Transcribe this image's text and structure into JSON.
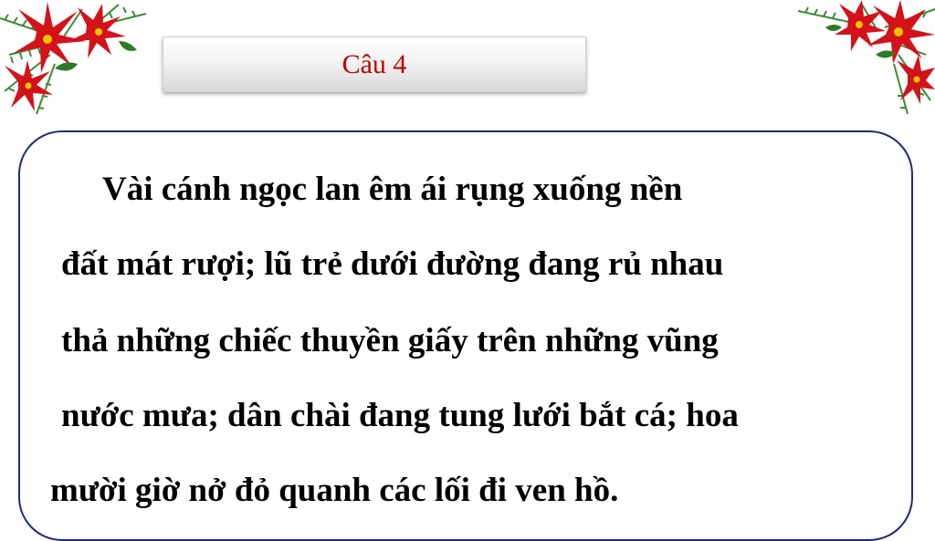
{
  "title": "Câu 4",
  "passage": {
    "lines": [
      "Vài cánh ngọc lan êm ái rụng xuống nền",
      "đất mát rượi; lũ trẻ dưới đường đang rủ nhau",
      "thả những chiếc thuyền giấy trên những vũng",
      "nước mưa; dân chài đang tung lưới bắt cá; hoa",
      "mười giờ nở đỏ quanh các lối đi ven hồ."
    ]
  },
  "colors": {
    "title_text": "#c00000",
    "card_border": "#1f2a7a",
    "poinsettia_red": "#d4121a",
    "pine_green": "#2f7a2a"
  },
  "decorations": [
    "poinsettia-decoration-left",
    "poinsettia-decoration-right"
  ]
}
